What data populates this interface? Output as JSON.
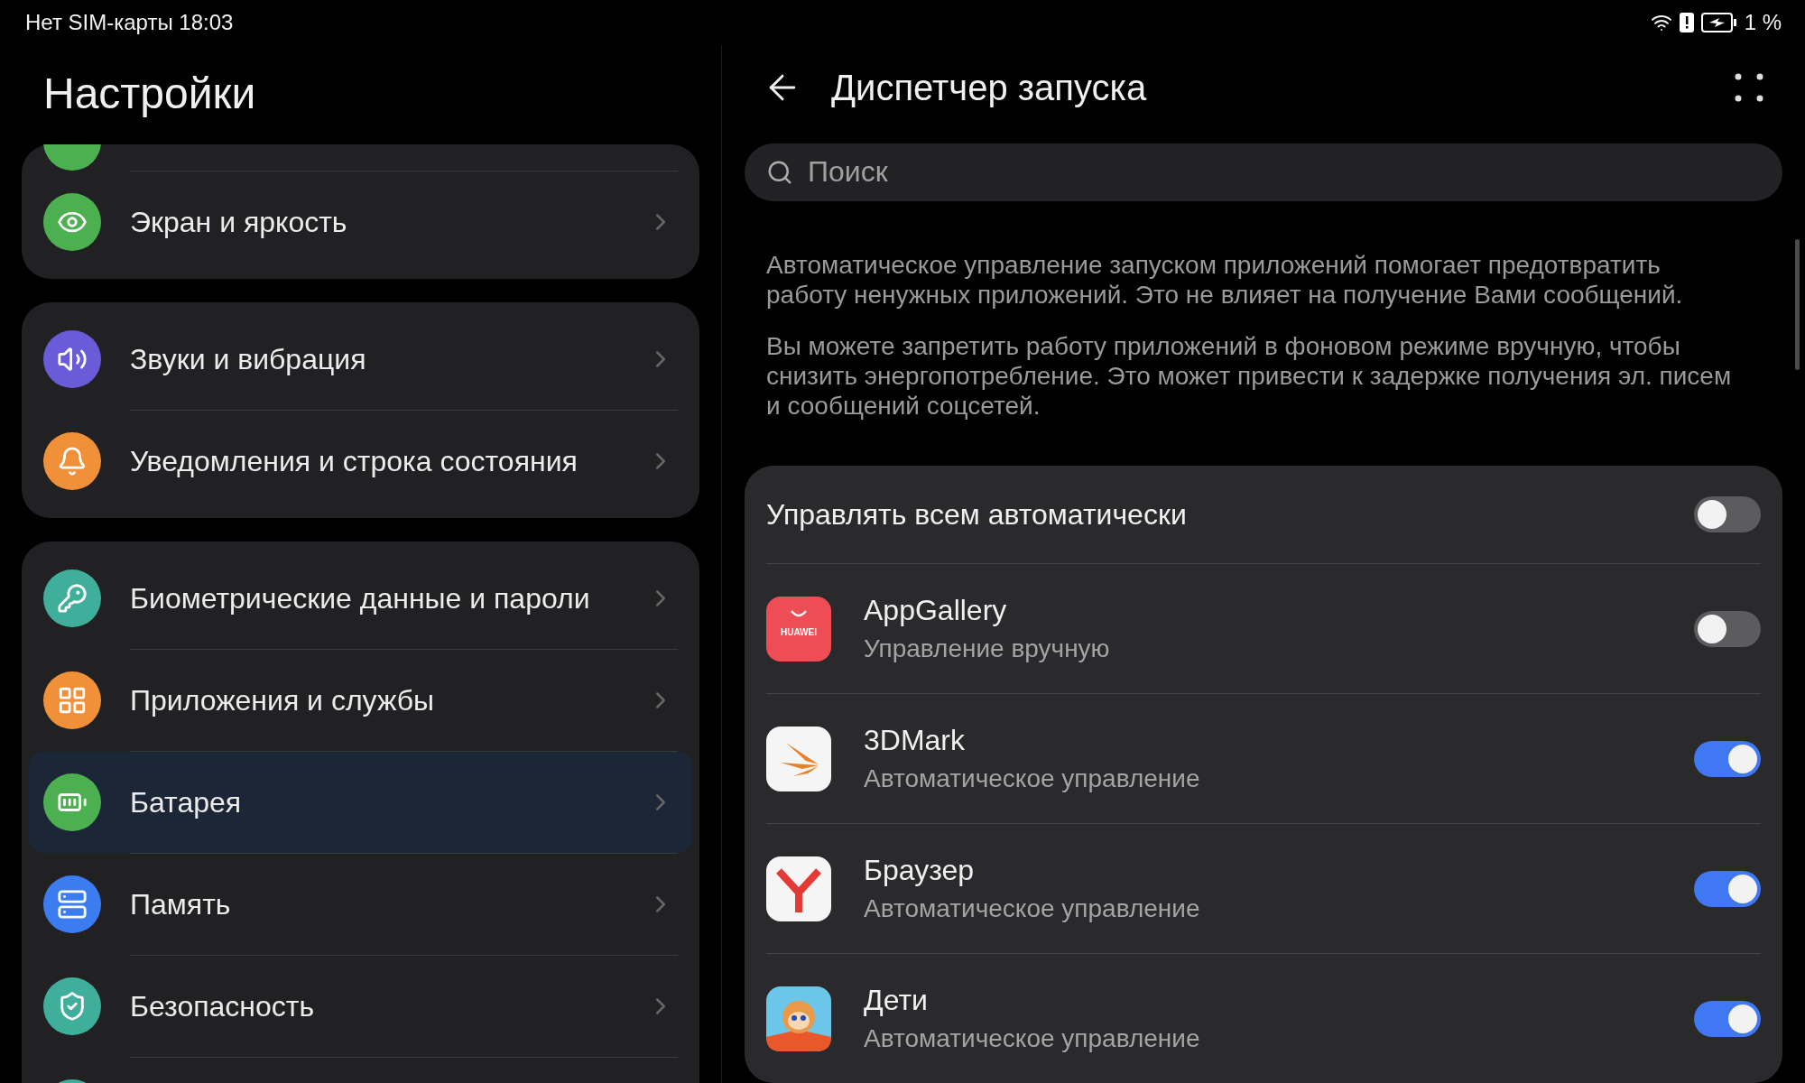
{
  "status_bar": {
    "carrier_time": "Нет SIM-карты 18:03",
    "battery": "1 %"
  },
  "settings": {
    "title": "Настройки",
    "groups": [
      {
        "items": [
          {
            "color": "#4caf50",
            "selected": false
          },
          {
            "label": "Экран и яркость",
            "color": "#4caf50",
            "selected": false
          }
        ]
      },
      {
        "items": [
          {
            "label": "Звуки и вибрация",
            "color": "#6a5bd8",
            "selected": false
          },
          {
            "label": "Уведомления и строка состояния",
            "color": "#f0913a",
            "selected": false
          }
        ]
      },
      {
        "items": [
          {
            "label": "Биометрические данные и пароли",
            "color": "#3fae9a",
            "selected": false
          },
          {
            "label": "Приложения и службы",
            "color": "#f0913a",
            "selected": false
          },
          {
            "label": "Батарея",
            "color": "#4caf50",
            "selected": true
          },
          {
            "label": "Память",
            "color": "#3b7df0",
            "selected": false
          },
          {
            "label": "Безопасность",
            "color": "#3fae9a",
            "selected": false
          },
          {
            "color": "#3fae9a",
            "selected": false
          }
        ]
      }
    ]
  },
  "launch_manager": {
    "title": "Диспетчер запуска",
    "search": {
      "placeholder": "Поиск"
    },
    "descriptions": [
      "Автоматическое управление запуском приложений помогает предотвратить работу ненужных приложений. Это не влияет на получение Вами сообщений.",
      "Вы можете запретить работу приложений в фоновом режиме вручную, чтобы снизить энергопотребление. Это может привести к задержке получения эл. писем и сообщений соцсетей."
    ],
    "manage_all": {
      "label": "Управлять всем автоматически",
      "on": false
    },
    "apps": [
      {
        "name": "AppGallery",
        "status": "Управление вручную",
        "on": false,
        "logo_text": "HUAWEI"
      },
      {
        "name": "3DMark",
        "status": "Автоматическое управление",
        "on": true
      },
      {
        "name": "Браузер",
        "status": "Автоматическое управление",
        "on": true
      },
      {
        "name": "Дети",
        "status": "Автоматическое управление",
        "on": true
      }
    ]
  }
}
